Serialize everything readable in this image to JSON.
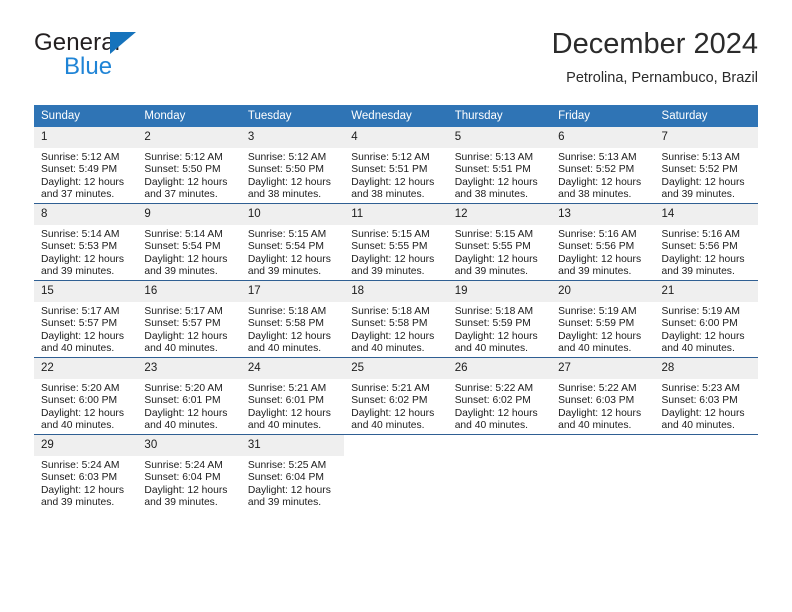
{
  "brand": {
    "name_part1": "General",
    "name_part2": "Blue",
    "triangle_color": "#1673bc",
    "blue_color": "#1f84d6"
  },
  "header": {
    "title": "December 2024",
    "subtitle": "Petrolina, Pernambuco, Brazil"
  },
  "theme": {
    "header_bg": "#2f74b5",
    "row_divider": "#2f5f93",
    "daynum_bg": "#efefef",
    "text": "#1c1c1c"
  },
  "weekdays": [
    "Sunday",
    "Monday",
    "Tuesday",
    "Wednesday",
    "Thursday",
    "Friday",
    "Saturday"
  ],
  "labels": {
    "sunrise_prefix": "Sunrise: ",
    "sunset_prefix": "Sunset: ",
    "daylight_prefix": "Daylight: "
  },
  "weeks": [
    [
      {
        "day": "1",
        "sunrise": "Sunrise: 5:12 AM",
        "sunset": "Sunset: 5:49 PM",
        "daylight1": "Daylight: 12 hours",
        "daylight2": "and 37 minutes."
      },
      {
        "day": "2",
        "sunrise": "Sunrise: 5:12 AM",
        "sunset": "Sunset: 5:50 PM",
        "daylight1": "Daylight: 12 hours",
        "daylight2": "and 37 minutes."
      },
      {
        "day": "3",
        "sunrise": "Sunrise: 5:12 AM",
        "sunset": "Sunset: 5:50 PM",
        "daylight1": "Daylight: 12 hours",
        "daylight2": "and 38 minutes."
      },
      {
        "day": "4",
        "sunrise": "Sunrise: 5:12 AM",
        "sunset": "Sunset: 5:51 PM",
        "daylight1": "Daylight: 12 hours",
        "daylight2": "and 38 minutes."
      },
      {
        "day": "5",
        "sunrise": "Sunrise: 5:13 AM",
        "sunset": "Sunset: 5:51 PM",
        "daylight1": "Daylight: 12 hours",
        "daylight2": "and 38 minutes."
      },
      {
        "day": "6",
        "sunrise": "Sunrise: 5:13 AM",
        "sunset": "Sunset: 5:52 PM",
        "daylight1": "Daylight: 12 hours",
        "daylight2": "and 38 minutes."
      },
      {
        "day": "7",
        "sunrise": "Sunrise: 5:13 AM",
        "sunset": "Sunset: 5:52 PM",
        "daylight1": "Daylight: 12 hours",
        "daylight2": "and 39 minutes."
      }
    ],
    [
      {
        "day": "8",
        "sunrise": "Sunrise: 5:14 AM",
        "sunset": "Sunset: 5:53 PM",
        "daylight1": "Daylight: 12 hours",
        "daylight2": "and 39 minutes."
      },
      {
        "day": "9",
        "sunrise": "Sunrise: 5:14 AM",
        "sunset": "Sunset: 5:54 PM",
        "daylight1": "Daylight: 12 hours",
        "daylight2": "and 39 minutes."
      },
      {
        "day": "10",
        "sunrise": "Sunrise: 5:15 AM",
        "sunset": "Sunset: 5:54 PM",
        "daylight1": "Daylight: 12 hours",
        "daylight2": "and 39 minutes."
      },
      {
        "day": "11",
        "sunrise": "Sunrise: 5:15 AM",
        "sunset": "Sunset: 5:55 PM",
        "daylight1": "Daylight: 12 hours",
        "daylight2": "and 39 minutes."
      },
      {
        "day": "12",
        "sunrise": "Sunrise: 5:15 AM",
        "sunset": "Sunset: 5:55 PM",
        "daylight1": "Daylight: 12 hours",
        "daylight2": "and 39 minutes."
      },
      {
        "day": "13",
        "sunrise": "Sunrise: 5:16 AM",
        "sunset": "Sunset: 5:56 PM",
        "daylight1": "Daylight: 12 hours",
        "daylight2": "and 39 minutes."
      },
      {
        "day": "14",
        "sunrise": "Sunrise: 5:16 AM",
        "sunset": "Sunset: 5:56 PM",
        "daylight1": "Daylight: 12 hours",
        "daylight2": "and 39 minutes."
      }
    ],
    [
      {
        "day": "15",
        "sunrise": "Sunrise: 5:17 AM",
        "sunset": "Sunset: 5:57 PM",
        "daylight1": "Daylight: 12 hours",
        "daylight2": "and 40 minutes."
      },
      {
        "day": "16",
        "sunrise": "Sunrise: 5:17 AM",
        "sunset": "Sunset: 5:57 PM",
        "daylight1": "Daylight: 12 hours",
        "daylight2": "and 40 minutes."
      },
      {
        "day": "17",
        "sunrise": "Sunrise: 5:18 AM",
        "sunset": "Sunset: 5:58 PM",
        "daylight1": "Daylight: 12 hours",
        "daylight2": "and 40 minutes."
      },
      {
        "day": "18",
        "sunrise": "Sunrise: 5:18 AM",
        "sunset": "Sunset: 5:58 PM",
        "daylight1": "Daylight: 12 hours",
        "daylight2": "and 40 minutes."
      },
      {
        "day": "19",
        "sunrise": "Sunrise: 5:18 AM",
        "sunset": "Sunset: 5:59 PM",
        "daylight1": "Daylight: 12 hours",
        "daylight2": "and 40 minutes."
      },
      {
        "day": "20",
        "sunrise": "Sunrise: 5:19 AM",
        "sunset": "Sunset: 5:59 PM",
        "daylight1": "Daylight: 12 hours",
        "daylight2": "and 40 minutes."
      },
      {
        "day": "21",
        "sunrise": "Sunrise: 5:19 AM",
        "sunset": "Sunset: 6:00 PM",
        "daylight1": "Daylight: 12 hours",
        "daylight2": "and 40 minutes."
      }
    ],
    [
      {
        "day": "22",
        "sunrise": "Sunrise: 5:20 AM",
        "sunset": "Sunset: 6:00 PM",
        "daylight1": "Daylight: 12 hours",
        "daylight2": "and 40 minutes."
      },
      {
        "day": "23",
        "sunrise": "Sunrise: 5:20 AM",
        "sunset": "Sunset: 6:01 PM",
        "daylight1": "Daylight: 12 hours",
        "daylight2": "and 40 minutes."
      },
      {
        "day": "24",
        "sunrise": "Sunrise: 5:21 AM",
        "sunset": "Sunset: 6:01 PM",
        "daylight1": "Daylight: 12 hours",
        "daylight2": "and 40 minutes."
      },
      {
        "day": "25",
        "sunrise": "Sunrise: 5:21 AM",
        "sunset": "Sunset: 6:02 PM",
        "daylight1": "Daylight: 12 hours",
        "daylight2": "and 40 minutes."
      },
      {
        "day": "26",
        "sunrise": "Sunrise: 5:22 AM",
        "sunset": "Sunset: 6:02 PM",
        "daylight1": "Daylight: 12 hours",
        "daylight2": "and 40 minutes."
      },
      {
        "day": "27",
        "sunrise": "Sunrise: 5:22 AM",
        "sunset": "Sunset: 6:03 PM",
        "daylight1": "Daylight: 12 hours",
        "daylight2": "and 40 minutes."
      },
      {
        "day": "28",
        "sunrise": "Sunrise: 5:23 AM",
        "sunset": "Sunset: 6:03 PM",
        "daylight1": "Daylight: 12 hours",
        "daylight2": "and 40 minutes."
      }
    ],
    [
      {
        "day": "29",
        "sunrise": "Sunrise: 5:24 AM",
        "sunset": "Sunset: 6:03 PM",
        "daylight1": "Daylight: 12 hours",
        "daylight2": "and 39 minutes."
      },
      {
        "day": "30",
        "sunrise": "Sunrise: 5:24 AM",
        "sunset": "Sunset: 6:04 PM",
        "daylight1": "Daylight: 12 hours",
        "daylight2": "and 39 minutes."
      },
      {
        "day": "31",
        "sunrise": "Sunrise: 5:25 AM",
        "sunset": "Sunset: 6:04 PM",
        "daylight1": "Daylight: 12 hours",
        "daylight2": "and 39 minutes."
      },
      {
        "day": "",
        "sunrise": "",
        "sunset": "",
        "daylight1": "",
        "daylight2": ""
      },
      {
        "day": "",
        "sunrise": "",
        "sunset": "",
        "daylight1": "",
        "daylight2": ""
      },
      {
        "day": "",
        "sunrise": "",
        "sunset": "",
        "daylight1": "",
        "daylight2": ""
      },
      {
        "day": "",
        "sunrise": "",
        "sunset": "",
        "daylight1": "",
        "daylight2": ""
      }
    ]
  ]
}
